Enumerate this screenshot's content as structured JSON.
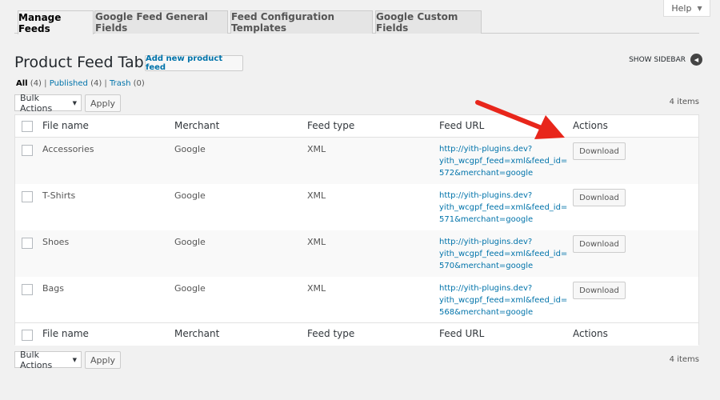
{
  "help": {
    "label": "Help",
    "icon": "caret-down-icon"
  },
  "tabs": [
    {
      "label": "Manage Feeds",
      "active": true
    },
    {
      "label": "Google Feed General Fields",
      "active": false
    },
    {
      "label": "Feed Configuration Templates",
      "active": false
    },
    {
      "label": "Google Custom Fields",
      "active": false
    }
  ],
  "page": {
    "title": "Product Feed Table",
    "add_new_label": "Add new product feed",
    "sidebar_toggle_label": "SHOW SIDEBAR"
  },
  "filters": {
    "all_label": "All",
    "all_count": "(4)",
    "published_label": "Published",
    "published_count": "(4)",
    "trash_label": "Trash",
    "trash_count": "(0)",
    "separator": "|"
  },
  "bulk": {
    "select_label": "Bulk Actions",
    "apply_label": "Apply",
    "items_count": "4 items"
  },
  "table": {
    "columns": [
      "File name",
      "Merchant",
      "Feed type",
      "Feed URL",
      "Actions"
    ],
    "rows": [
      {
        "file_name": "Accessories",
        "merchant": "Google",
        "feed_type": "XML",
        "url_line1": "http://yith-plugins.dev?",
        "url_line2": "yith_wcgpf_feed=xml&feed_id=",
        "url_line3": "572&merchant=google",
        "action": "Download"
      },
      {
        "file_name": "T-Shirts",
        "merchant": "Google",
        "feed_type": "XML",
        "url_line1": "http://yith-plugins.dev?",
        "url_line2": "yith_wcgpf_feed=xml&feed_id=",
        "url_line3": "571&merchant=google",
        "action": "Download"
      },
      {
        "file_name": "Shoes",
        "merchant": "Google",
        "feed_type": "XML",
        "url_line1": "http://yith-plugins.dev?",
        "url_line2": "yith_wcgpf_feed=xml&feed_id=",
        "url_line3": "570&merchant=google",
        "action": "Download"
      },
      {
        "file_name": "Bags",
        "merchant": "Google",
        "feed_type": "XML",
        "url_line1": "http://yith-plugins.dev?",
        "url_line2": "yith_wcgpf_feed=xml&feed_id=",
        "url_line3": "568&merchant=google",
        "action": "Download"
      }
    ]
  },
  "colors": {
    "link": "#0073aa",
    "arrow": "#e8261b",
    "background": "#f1f1f1"
  },
  "annotation_icon": "red-arrow-icon"
}
